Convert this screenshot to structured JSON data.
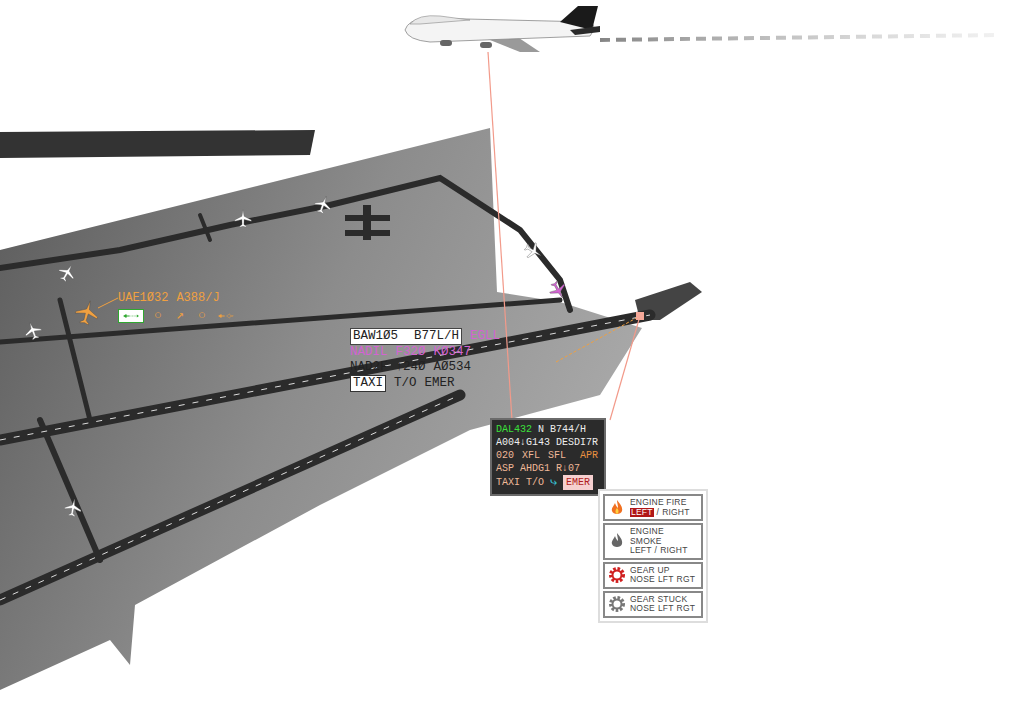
{
  "uae_tag": {
    "callsign": "UAE1Ø32",
    "type": "A388/J",
    "color": "#f0a040",
    "actions": [
      {
        "kind": "plane-arrow",
        "selected": true
      },
      {
        "kind": "glyph",
        "text": "○",
        "selected": false
      },
      {
        "kind": "glyph",
        "text": "↗",
        "selected": false
      },
      {
        "kind": "glyph",
        "text": "○",
        "selected": false
      },
      {
        "kind": "plane-swap",
        "selected": false
      }
    ]
  },
  "baw_tag": {
    "callsign": "BAW1Ø5",
    "type": "B77L/H",
    "dest": "EGLL",
    "color": "#d264d2",
    "line2": [
      "NADIL",
      "F32Ø",
      "KØ347"
    ],
    "line3": [
      "NAD2F",
      "↑24Ø",
      "AØ534"
    ],
    "commands": [
      {
        "label": "TAXI",
        "selected": true
      },
      {
        "label": "T/O",
        "selected": false
      },
      {
        "label": "EMER",
        "selected": false
      }
    ]
  },
  "dal_tag": {
    "callsign": "DAL432",
    "wake": "N",
    "type": "B744/H",
    "line2": [
      "A004↓G143",
      "DESDI7R"
    ],
    "line3": [
      "020",
      "XFL",
      "SFL"
    ],
    "status": "APR",
    "line4": [
      "ASP",
      "AHDG1",
      "R↓07"
    ],
    "commands": [
      {
        "label": "TAXI",
        "selected": false
      },
      {
        "label": "T/O",
        "selected": false
      }
    ],
    "arrow": "⤷",
    "emer": {
      "label": "EMER",
      "selected": true
    }
  },
  "emergency_menu": [
    {
      "kind": "fire",
      "label": "ENGINE FIRE",
      "separator": "/",
      "options": [
        {
          "label": "LEFT",
          "selected": true
        },
        {
          "label": "RIGHT",
          "selected": false
        }
      ]
    },
    {
      "kind": "smoke",
      "label": "ENGINE SMOKE",
      "separator": "/",
      "options": [
        {
          "label": "LEFT",
          "selected": false
        },
        {
          "label": "RIGHT",
          "selected": false
        }
      ]
    },
    {
      "kind": "gear-up",
      "label": "GEAR UP",
      "separator": "",
      "options": [
        {
          "label": "NOSE",
          "selected": false
        },
        {
          "label": "LFT",
          "selected": false
        },
        {
          "label": "RGT",
          "selected": false
        }
      ]
    },
    {
      "kind": "gear-stuck",
      "label": "GEAR STUCK",
      "separator": "",
      "options": [
        {
          "label": "NOSE",
          "selected": false
        },
        {
          "label": "LFT",
          "selected": false
        },
        {
          "label": "RGT",
          "selected": false
        }
      ]
    }
  ]
}
